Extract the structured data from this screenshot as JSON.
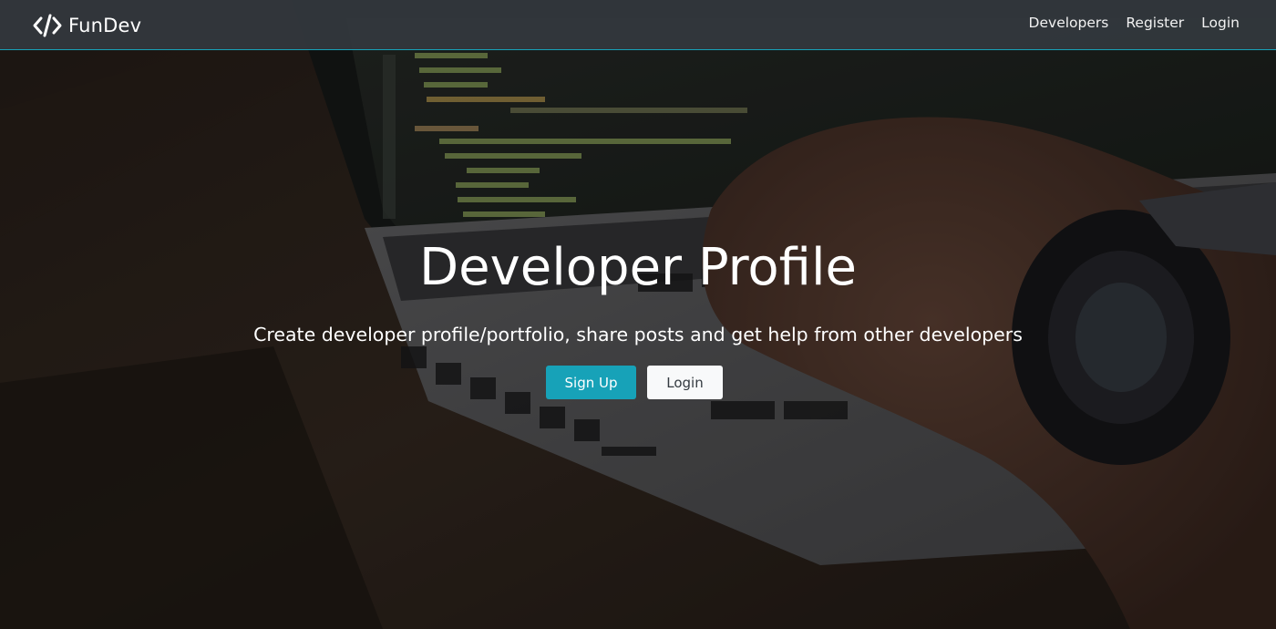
{
  "brand": {
    "icon": "code-icon",
    "name": "FunDev"
  },
  "nav": {
    "links": [
      "Developers",
      "Register",
      "Login"
    ]
  },
  "hero": {
    "title": "Developer Profile",
    "subtitle": "Create developer profile/portfolio, share posts and get help from other developers",
    "signup_label": "Sign Up",
    "login_label": "Login"
  },
  "colors": {
    "accent": "#17a2b8",
    "navbar": "#343a40",
    "light_button": "#f8f9fa"
  }
}
